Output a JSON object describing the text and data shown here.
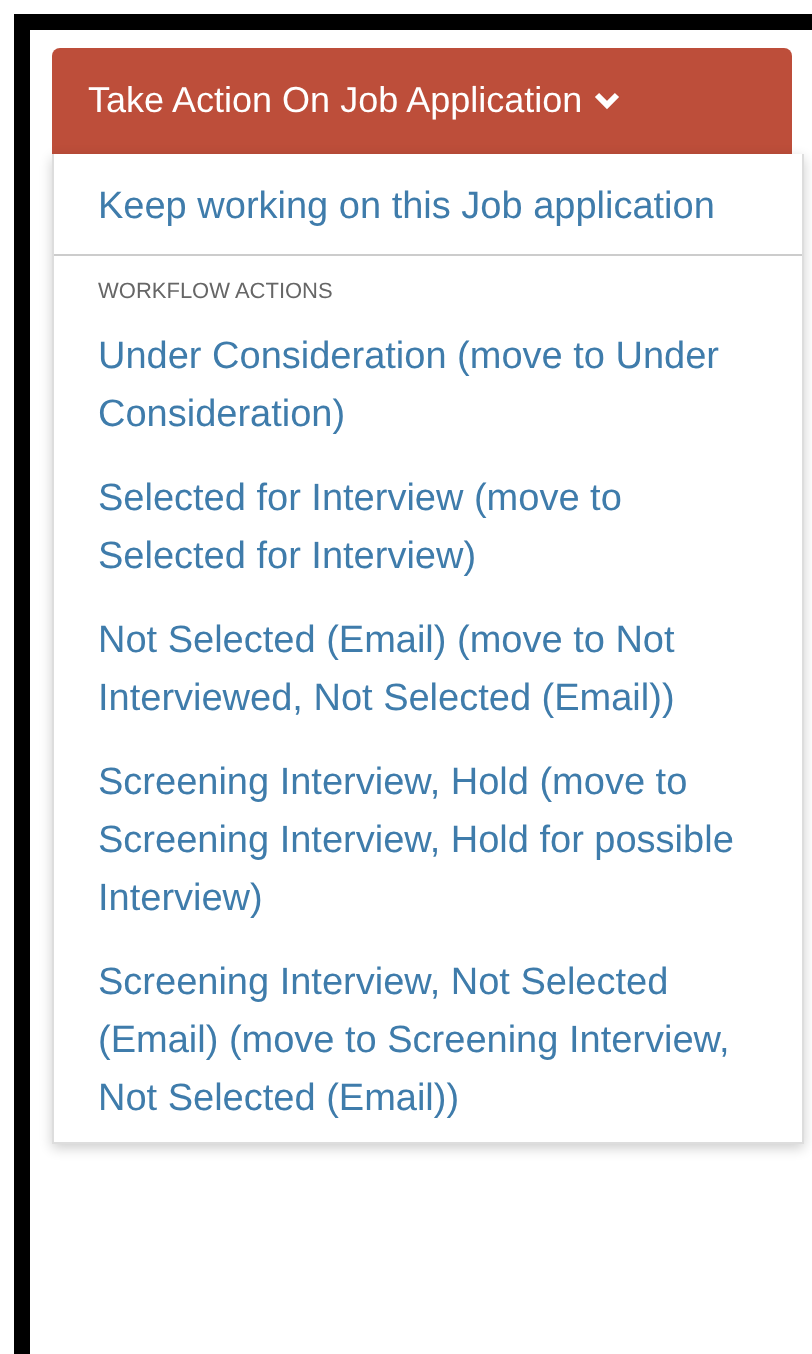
{
  "button": {
    "label": "Take Action On Job Application",
    "expanded": true
  },
  "menu": {
    "top_item": "Keep working on this Job application",
    "section_header": "WORKFLOW ACTIONS",
    "items": [
      "Under Consideration (move to Under Consideration)",
      "Selected for Interview (move to Selected for Interview)",
      "Not Selected (Email) (move to Not Interviewed, Not Selected (Email))",
      "Screening Interview, Hold (move to Screening Interview, Hold for possible Interview)",
      "Screening Interview, Not Selected (Email) (move to Screening Interview, Not Selected (Email))"
    ]
  }
}
